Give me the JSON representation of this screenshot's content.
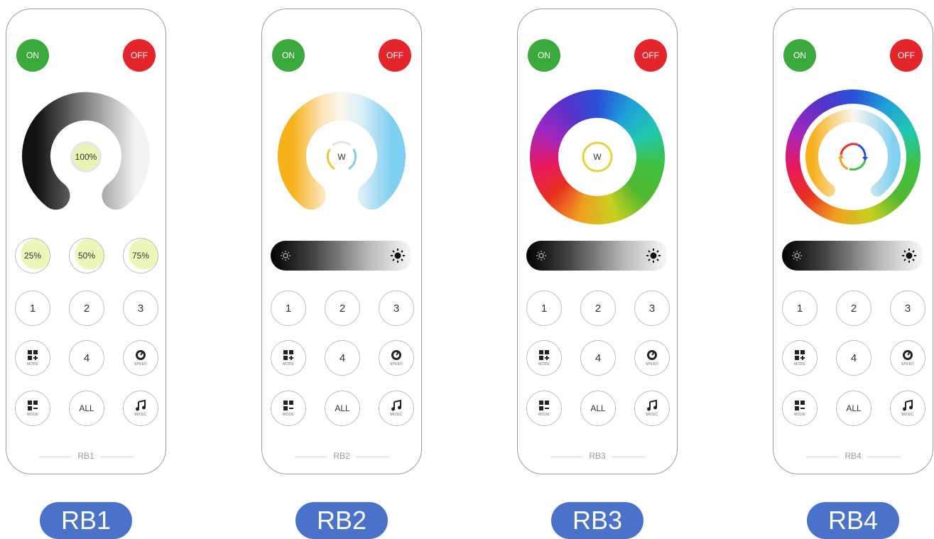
{
  "buttons": {
    "on": "ON",
    "off": "OFF",
    "one": "1",
    "two": "2",
    "three": "3",
    "four": "4",
    "all": "ALL",
    "mode": "MODE",
    "speed": "SPEED",
    "music": "MUSIC"
  },
  "rb1": {
    "center": "100%",
    "pct": [
      "25%",
      "50%",
      "75%"
    ],
    "footer": "RB1",
    "pill": "RB1"
  },
  "rb2": {
    "center": "W",
    "footer": "RB2",
    "pill": "RB2"
  },
  "rb3": {
    "center": "W",
    "footer": "RB3",
    "pill": "RB3"
  },
  "rb4": {
    "footer": "RB4",
    "pill": "RB4"
  },
  "colors": {
    "on": "#3aaa3c",
    "off": "#e2262c",
    "pill": "#4a72c9",
    "frame": "#9a9a9a"
  },
  "icons": [
    "sun-low-icon",
    "sun-high-icon",
    "mode-plus-icon",
    "mode-minus-icon",
    "speed-icon",
    "music-icon",
    "refresh-icon"
  ]
}
